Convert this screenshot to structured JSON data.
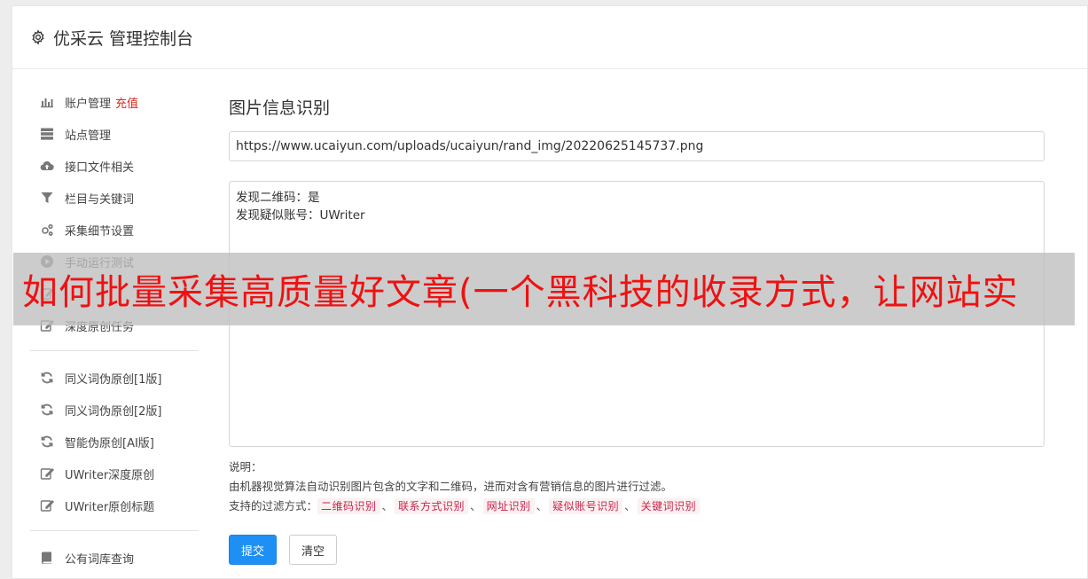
{
  "header": {
    "title": "优采云 管理控制台"
  },
  "sidebar": {
    "groups": [
      [
        {
          "label": "账户管理",
          "extra": "充值",
          "icon": "bar-chart-icon"
        },
        {
          "label": "站点管理",
          "icon": "server-icon"
        },
        {
          "label": "接口文件相关",
          "icon": "cloud-upload-icon"
        },
        {
          "label": "栏目与关键词",
          "icon": "filter-icon"
        },
        {
          "label": "采集细节设置",
          "icon": "cogs-icon"
        },
        {
          "label": "手动运行测试",
          "icon": "play-circle-icon"
        },
        {
          "label": "",
          "icon": "edit-icon"
        },
        {
          "label": "深度原创任务",
          "icon": "edit-icon"
        }
      ],
      [
        {
          "label": "同义词伪原创[1版]",
          "icon": "refresh-icon"
        },
        {
          "label": "同义词伪原创[2版]",
          "icon": "refresh-icon"
        },
        {
          "label": "智能伪原创[AI版]",
          "icon": "refresh-icon"
        },
        {
          "label": "UWriter深度原创",
          "icon": "edit-icon"
        },
        {
          "label": "UWriter原创标题",
          "icon": "edit-icon"
        }
      ],
      [
        {
          "label": "公有词库查询",
          "icon": "book-icon"
        }
      ]
    ]
  },
  "main": {
    "title": "图片信息识别",
    "url_value": "https://www.ucaiyun.com/uploads/ucaiyun/rand_img/20220625145737.png",
    "result_lines": [
      "发现二维码：是",
      "发现疑似账号：UWriter"
    ],
    "notes_heading": "说明：",
    "notes_desc": "由机器视觉算法自动识别图片包含的文字和二维码，进而对含有营销信息的图片进行过滤。",
    "filters_label": "支持的过滤方式：",
    "filters": [
      "二维码识别",
      "联系方式识别",
      "网址识别",
      "疑似账号识别",
      "关键词识别"
    ],
    "filter_sep": "、",
    "submit_label": "提交",
    "clear_label": "清空"
  },
  "overlay": {
    "text": "如何批量采集高质量好文章(一个黑科技的收录方式，让网站实"
  }
}
